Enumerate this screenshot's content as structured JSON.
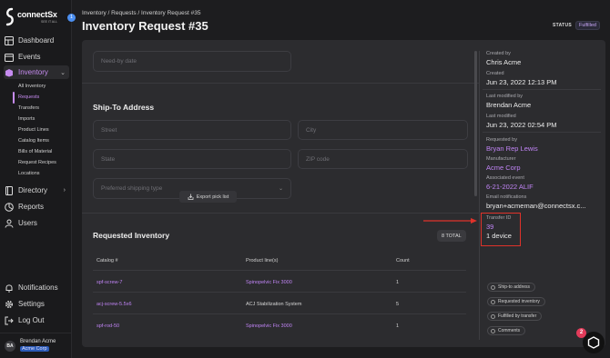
{
  "sidebar": {
    "logo_text": "connectSx",
    "logo_sub": "SEE IT ALL",
    "collapse_badge": "1",
    "items": [
      {
        "label": "Dashboard",
        "icon": "dashboard-icon"
      },
      {
        "label": "Events",
        "icon": "calendar-icon"
      },
      {
        "label": "Inventory",
        "icon": "box-icon"
      },
      {
        "label": "Directory",
        "icon": "book-icon"
      },
      {
        "label": "Reports",
        "icon": "chart-icon"
      },
      {
        "label": "Users",
        "icon": "users-icon"
      }
    ],
    "inventory_sub": [
      "All Inventory",
      "Requests",
      "Transfers",
      "Imports",
      "Product Lines",
      "Catalog Items",
      "Bills of Material",
      "Request Recipes",
      "Locations"
    ],
    "bottom": [
      {
        "label": "Notifications",
        "icon": "bell-icon"
      },
      {
        "label": "Settings",
        "icon": "gear-icon"
      },
      {
        "label": "Log Out",
        "icon": "logout-icon"
      }
    ],
    "user": {
      "initials": "BA",
      "name": "Brendan Acme",
      "org": "Acme Corp"
    }
  },
  "header": {
    "breadcrumb": "Inventory / Requests / Inventory Request #35",
    "title": "Inventory Request #35",
    "status_label": "STATUS",
    "status_value": "Fulfilled"
  },
  "form": {
    "need_by_placeholder": "Need-by date",
    "ship_to_title": "Ship-To Address",
    "street_placeholder": "Street",
    "city_placeholder": "City",
    "state_placeholder": "State",
    "zip_placeholder": "ZIP code",
    "shipping_placeholder": "Preferred shipping type"
  },
  "inventory": {
    "title": "Requested Inventory",
    "export_label": "Export pick list",
    "total_label": "8 TOTAL",
    "columns": [
      "Catalog #",
      "Product line(s)",
      "Count"
    ],
    "rows": [
      {
        "catalog": "spf-screw-7",
        "product": "Spinopelvic Fix 3000",
        "count": "1"
      },
      {
        "catalog": "acj-screw-5.5x6",
        "product": "ACJ Stabilization System",
        "count": "5"
      },
      {
        "catalog": "spf-rod-50",
        "product": "Spinopelvic Fix 3000",
        "count": "1"
      }
    ]
  },
  "meta": {
    "created_by_label": "Created by",
    "created_by": "Chris Acme",
    "created_label": "Created",
    "created": "Jun 23, 2022 12:13 PM",
    "modified_by_label": "Last modified by",
    "modified_by": "Brendan Acme",
    "modified_label": "Last modified",
    "modified": "Jun 23, 2022 02:54 PM",
    "requested_by_label": "Requested by",
    "requested_by": "Bryan Rep Lewis",
    "manufacturer_label": "Manufacturer",
    "manufacturer": "Acme Corp",
    "event_label": "Associated event",
    "event": "6-21-2022 ALIF",
    "email_label": "Email notifications",
    "email": "bryan+acmeman@connectsx.c...",
    "transfer_label": "Transfer ID",
    "transfer_id": "39",
    "transfer_devices": "1 device"
  },
  "chips": [
    "Ship-to address",
    "Requested inventory",
    "Fulfilled by transfer",
    "Comments"
  ],
  "help_badge": "2",
  "colors": {
    "accent": "#c084f5",
    "annotation": "#e0322a",
    "status_bg": "#2a2a38"
  }
}
